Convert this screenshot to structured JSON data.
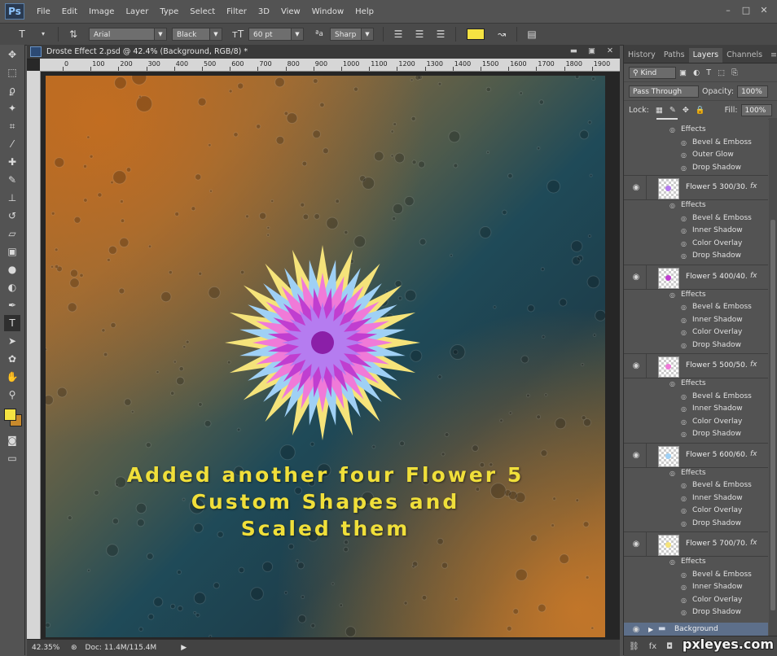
{
  "menubar": {
    "logo": "Ps",
    "items": [
      "File",
      "Edit",
      "Image",
      "Layer",
      "Type",
      "Select",
      "Filter",
      "3D",
      "View",
      "Window",
      "Help"
    ]
  },
  "options": {
    "tool_icon": "T",
    "font_family": "Arial",
    "font_style": "Black",
    "font_size": "60 pt",
    "aa_label": "ªa",
    "antialias": "Sharp",
    "text_color": "#f5e342"
  },
  "document": {
    "title": "Droste Effect 2.psd @ 42.4% (Background, RGB/8) *",
    "ruler_ticks": [
      "0",
      "100",
      "200",
      "300",
      "400",
      "500",
      "600",
      "700",
      "800",
      "900",
      "1000",
      "1100",
      "1200",
      "1300",
      "1400",
      "1500",
      "1600",
      "1700",
      "1800",
      "1900"
    ],
    "caption_lines": [
      "Added another four Flower 5",
      "Custom Shapes and",
      "Scaled them"
    ],
    "caption_color": "#f0df3a"
  },
  "status": {
    "zoom": "42.35%",
    "doc": "Doc: 11.4M/115.4M"
  },
  "panel": {
    "tabs": [
      "History",
      "Paths",
      "Layers",
      "Channels"
    ],
    "active_tab": "Layers",
    "filter_kind": "Kind",
    "blend_mode": "Pass Through",
    "opacity_label": "Opacity:",
    "opacity": "100%",
    "lock_label": "Lock:",
    "fill_label": "Fill:",
    "fill": "100%",
    "top_effects": [
      "Effects",
      "Bevel & Emboss",
      "Outer Glow",
      "Drop Shadow"
    ],
    "layers": [
      {
        "name": "Flower 5 300/30...",
        "color": "#b57cf0",
        "effects": [
          "Effects",
          "Bevel & Emboss",
          "Inner Shadow",
          "Color Overlay",
          "Drop Shadow"
        ]
      },
      {
        "name": "Flower 5 400/40...",
        "color": "#c03ed0",
        "effects": [
          "Effects",
          "Bevel & Emboss",
          "Inner Shadow",
          "Color Overlay",
          "Drop Shadow"
        ]
      },
      {
        "name": "Flower 5 500/50...",
        "color": "#f07ad8",
        "effects": [
          "Effects",
          "Bevel & Emboss",
          "Inner Shadow",
          "Color Overlay",
          "Drop Shadow"
        ]
      },
      {
        "name": "Flower 5 600/60...",
        "color": "#9fd0f5",
        "effects": [
          "Effects",
          "Bevel & Emboss",
          "Inner Shadow",
          "Color Overlay",
          "Drop Shadow"
        ]
      },
      {
        "name": "Flower 5 700/70...",
        "color": "#f5e37a",
        "effects": [
          "Effects",
          "Bevel & Emboss",
          "Inner Shadow",
          "Color Overlay",
          "Drop Shadow"
        ]
      }
    ],
    "background_layer": "Background",
    "fx_label": "fx"
  },
  "watermark": "pxleyes.com",
  "colors": {
    "foreground": "#f5e342",
    "background": "#c98a2c"
  }
}
